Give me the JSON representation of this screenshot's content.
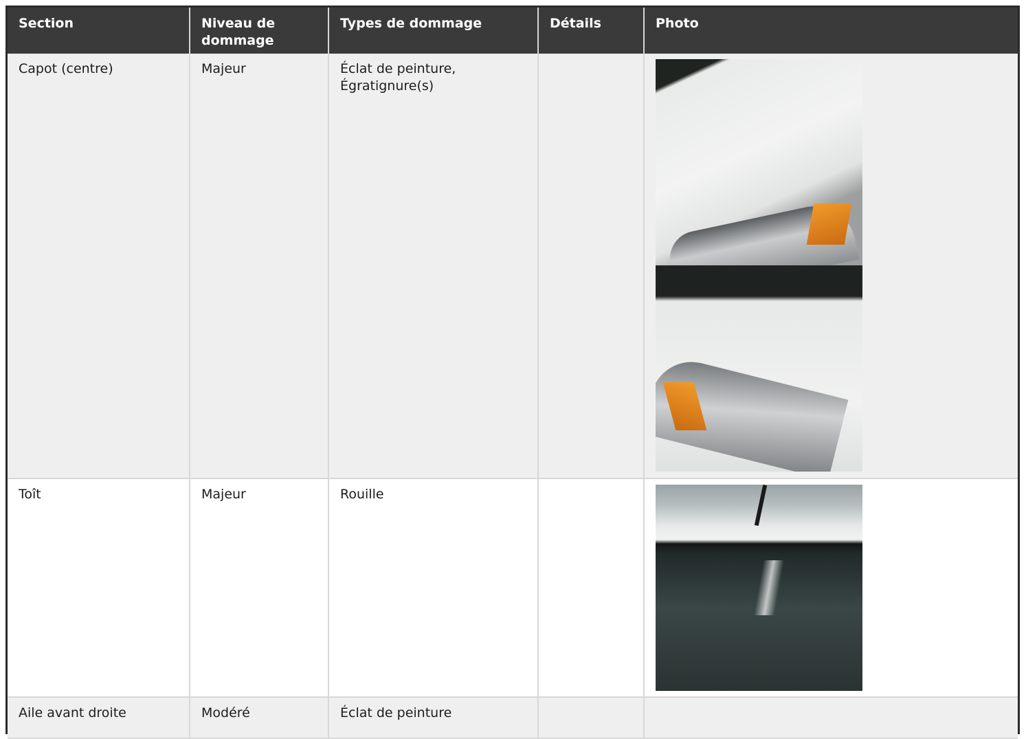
{
  "table": {
    "headers": {
      "section": "Section",
      "niveau": "Niveau de dommage",
      "types": "Types de dommage",
      "details": "Détails",
      "photo": "Photo"
    },
    "rows": [
      {
        "section": "Capot (centre)",
        "niveau": "Majeur",
        "types": "Éclat de peinture, Égratignure(s)",
        "details": "",
        "photos": [
          "hood-headlight-right-photo",
          "hood-headlight-left-photo"
        ]
      },
      {
        "section": "Toît",
        "niveau": "Majeur",
        "types": "Rouille",
        "details": "",
        "photos": [
          "roof-windshield-photo"
        ]
      },
      {
        "section": "Aile avant droite",
        "niveau": "Modéré",
        "types": "Éclat de peinture",
        "details": "",
        "photos": []
      }
    ]
  },
  "colors": {
    "header_bg": "#3a3a3a",
    "shaded_row": "#efefef",
    "border": "#d8d8d8"
  }
}
